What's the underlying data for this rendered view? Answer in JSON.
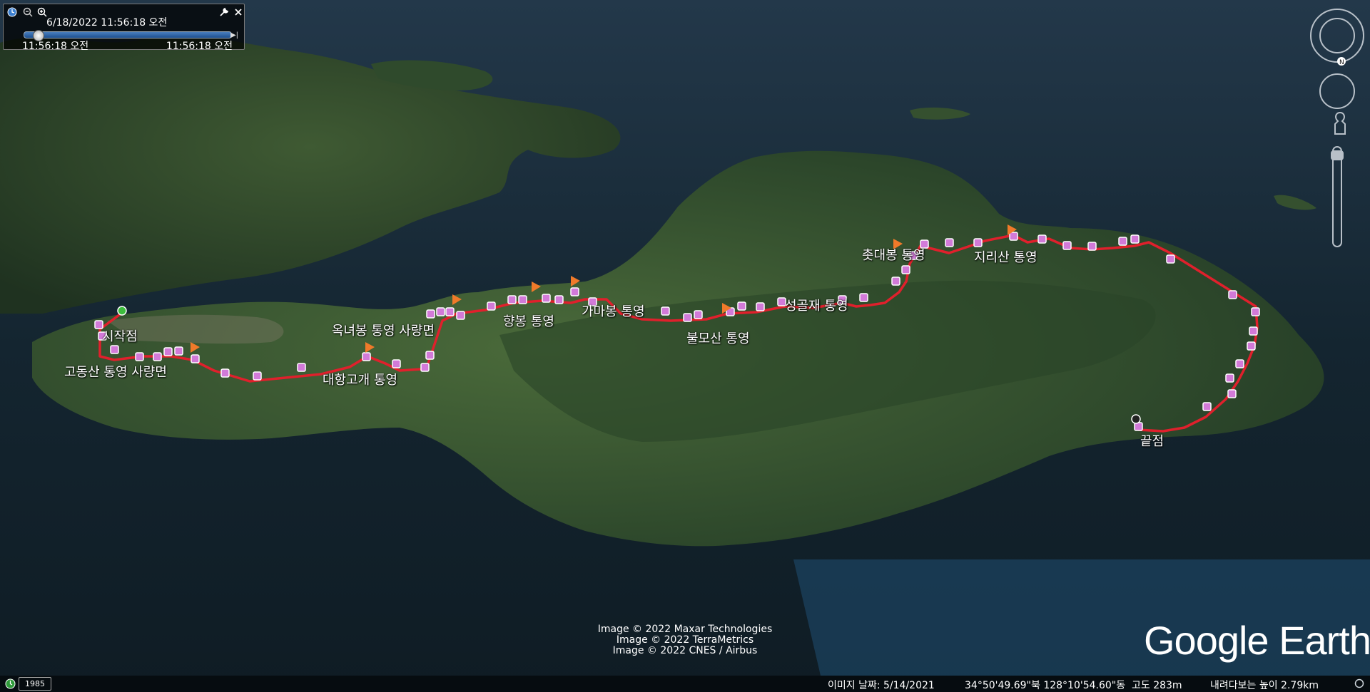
{
  "time_slider": {
    "current_time": "6/18/2022  11:56:18 오전",
    "start_time": "11:56:18 오전",
    "end_time": "11:56:18 오전"
  },
  "credits": [
    "Image © 2022 Maxar Technologies",
    "Image © 2022 TerraMetrics",
    "Image © 2022 CNES / Airbus"
  ],
  "logo_text": "Google Earth",
  "status_bar": {
    "year": "1985",
    "imagery_date": "이미지 날짜: 5/14/2021",
    "coordinates": "34°50'49.69\"북  128°10'54.60\"동",
    "elevation": "고도   283m",
    "eye_altitude": "내려다보는 높이   2.79km"
  },
  "compass_north": "N",
  "waypoint_labels": [
    "시작점",
    "고동산 통영 사량면",
    "대항고개 통영",
    "옥녀봉 통영 사량면",
    "향봉 통영",
    "가마봉 통영",
    "불모산 통영",
    "성골재 통영",
    "촛대봉 통영",
    "지리산 통영",
    "끝점"
  ],
  "route_color": "#e0202c",
  "marker_color": "#d27ad8",
  "flag_color": "#f07a2a"
}
